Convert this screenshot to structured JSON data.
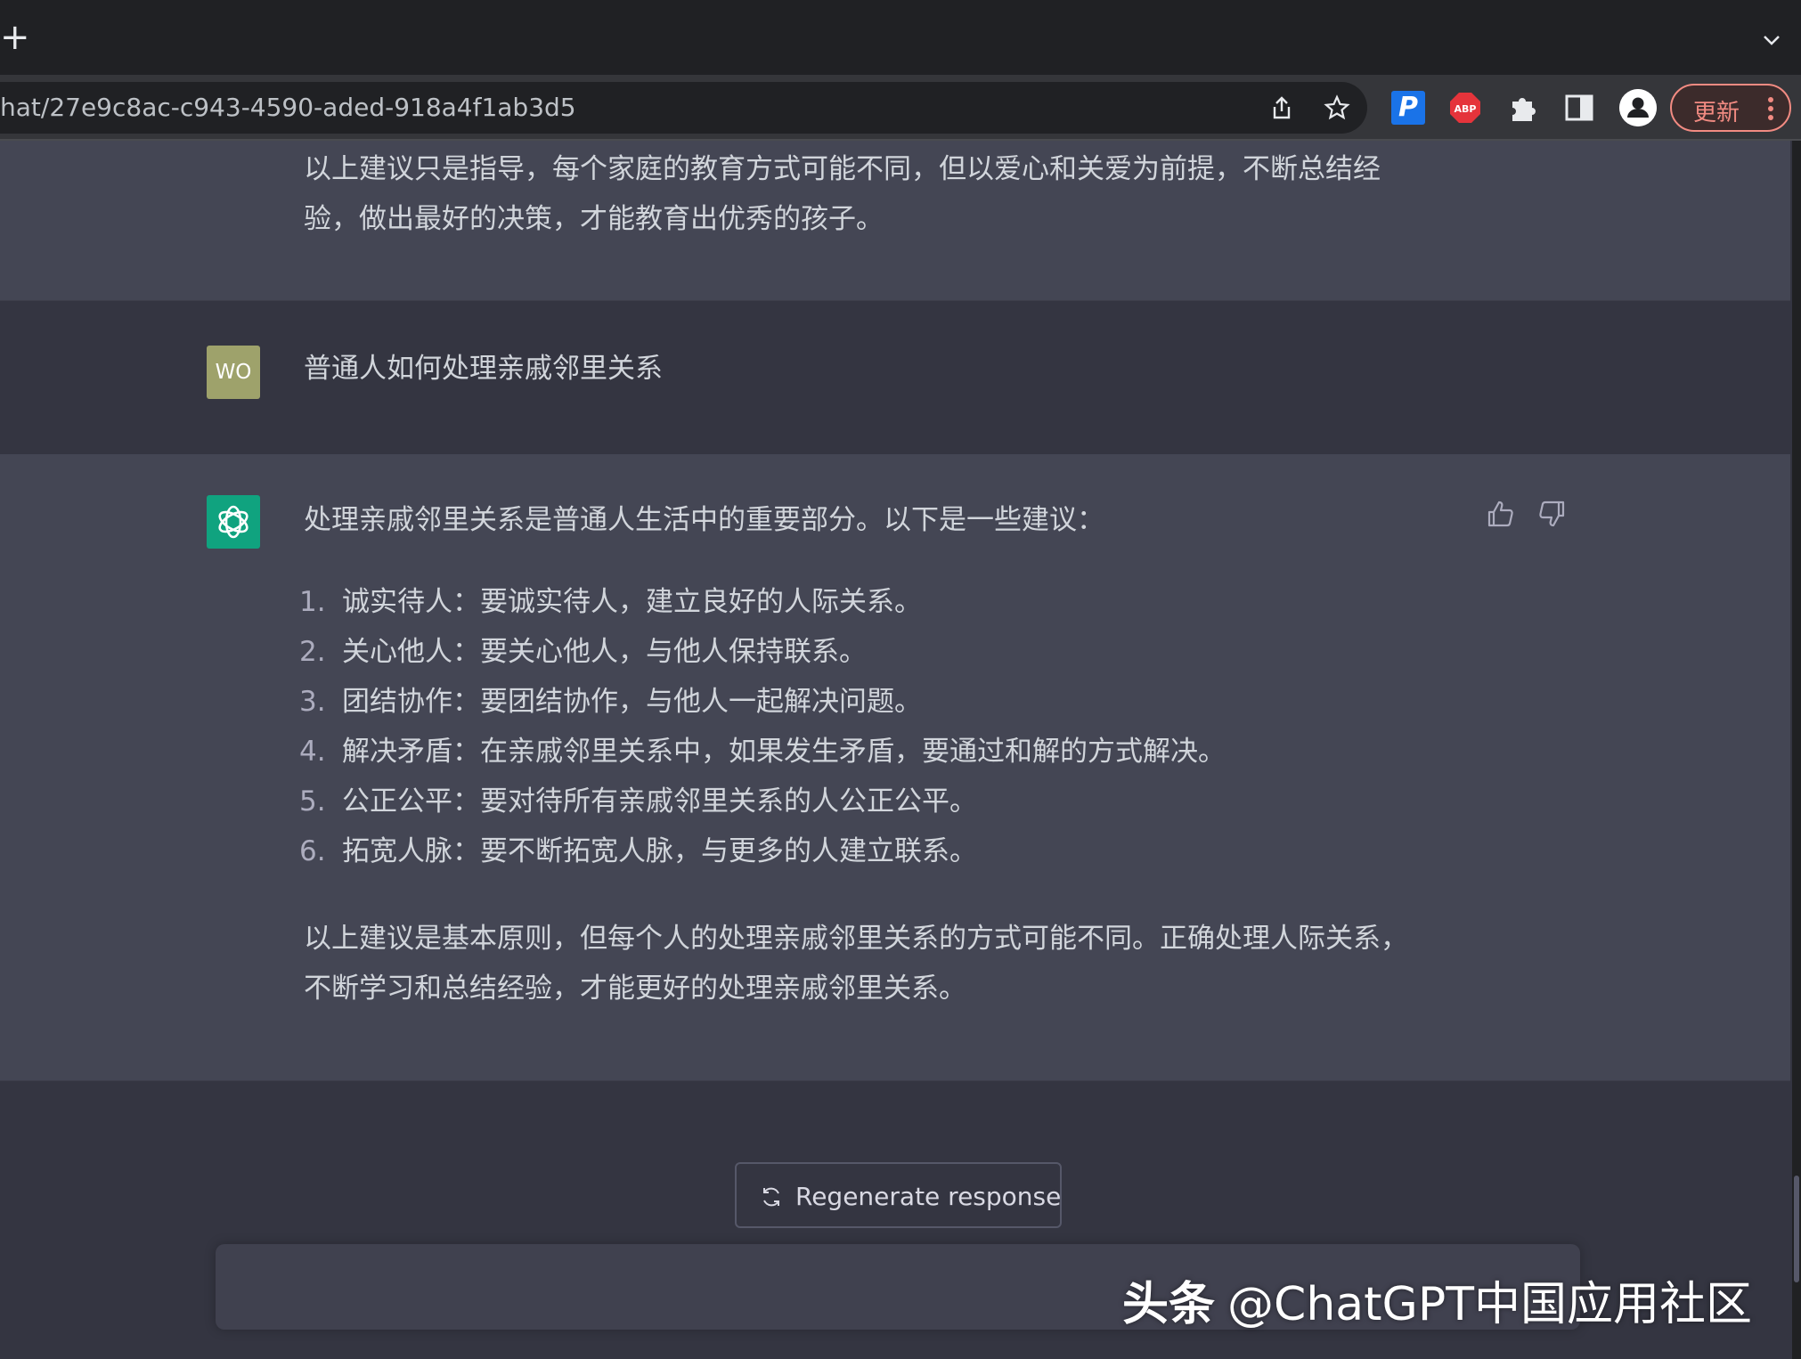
{
  "browser": {
    "new_tab_glyph": "+",
    "url": "hat/27e9c8ac-c943-4590-aded-918a4f1ab3d5",
    "ext_p_label": "P",
    "ext_abp_label": "ABP",
    "update_label": "更新",
    "accent": "#f28b82"
  },
  "conversation": {
    "prev_response_tail": {
      "lines": [
        "以上建议只是指导，每个家庭的教育方式可能不同，但以爱心和关爱为前提，不断总结经",
        "验，做出最好的决策，才能教育出优秀的孩子。"
      ]
    },
    "user_message": {
      "avatar_initials": "WO",
      "text": "普通人如何处理亲戚邻里关系"
    },
    "assistant_message": {
      "intro": "处理亲戚邻里关系是普通人生活中的重要部分。以下是一些建议：",
      "items": [
        {
          "num": "1.",
          "text": "诚实待人：要诚实待人，建立良好的人际关系。"
        },
        {
          "num": "2.",
          "text": "关心他人：要关心他人，与他人保持联系。"
        },
        {
          "num": "3.",
          "text": "团结协作：要团结协作，与他人一起解决问题。"
        },
        {
          "num": "4.",
          "text": "解决矛盾：在亲戚邻里关系中，如果发生矛盾，要通过和解的方式解决。"
        },
        {
          "num": "5.",
          "text": "公正公平：要对待所有亲戚邻里关系的人公正公平。"
        },
        {
          "num": "6.",
          "text": "拓宽人脉：要不断拓宽人脉，与更多的人建立联系。"
        }
      ],
      "outro_lines": [
        "以上建议是基本原则，但每个人的处理亲戚邻里关系的方式可能不同。正确处理人际关系，",
        "不断学习和总结经验，才能更好的处理亲戚邻里关系。"
      ]
    }
  },
  "actions": {
    "regenerate_label": "Regenerate response"
  },
  "watermark": {
    "brand": "头条",
    "handle": "@ChatGPT中国应用社区"
  },
  "colors": {
    "assistant_bg": "#444654",
    "user_bg": "#343541",
    "gpt_avatar": "#10a37f",
    "user_avatar": "#9ea26b"
  }
}
